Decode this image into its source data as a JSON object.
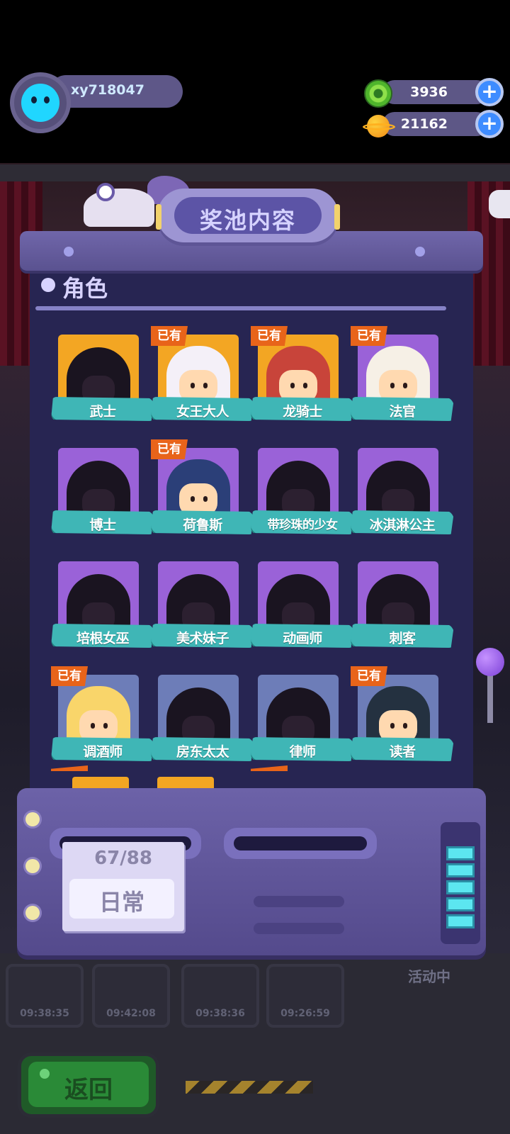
{
  "header": {
    "username": "xy718047",
    "currencies": [
      {
        "name": "green-donut-coin",
        "value": "3936"
      },
      {
        "name": "planet-coin",
        "value": "21162"
      }
    ],
    "plus_label": "+"
  },
  "panel": {
    "title": "奖池内容",
    "section_label": "角色"
  },
  "characters": [
    {
      "name": "武士",
      "owned": false,
      "card": "gold"
    },
    {
      "name": "女王大人",
      "owned": true,
      "card": "gold"
    },
    {
      "name": "龙骑士",
      "owned": true,
      "card": "gold"
    },
    {
      "name": "法官",
      "owned": true,
      "card": "purple"
    },
    {
      "name": "博士",
      "owned": false,
      "card": "purple"
    },
    {
      "name": "荷鲁斯",
      "owned": true,
      "card": "purple"
    },
    {
      "name": "带珍珠的少女",
      "owned": false,
      "card": "purple"
    },
    {
      "name": "冰淇淋公主",
      "owned": false,
      "card": "purple"
    },
    {
      "name": "培根女巫",
      "owned": false,
      "card": "purple"
    },
    {
      "name": "美术妹子",
      "owned": false,
      "card": "purple"
    },
    {
      "name": "动画师",
      "owned": false,
      "card": "purple"
    },
    {
      "name": "刺客",
      "owned": false,
      "card": "purple"
    },
    {
      "name": "调酒师",
      "owned": true,
      "card": "blue"
    },
    {
      "name": "房东太太",
      "owned": false,
      "card": "blue"
    },
    {
      "name": "律师",
      "owned": false,
      "card": "blue"
    },
    {
      "name": "读者",
      "owned": true,
      "card": "blue"
    }
  ],
  "owned_tag": "已有",
  "collection": {
    "count": "67/88",
    "pool_type": "日常"
  },
  "background": {
    "timers": [
      "09:38:35",
      "09:42:08",
      "09:38:36",
      "09:26:59"
    ],
    "event_label": "活动中"
  },
  "back_button": "返回",
  "colors": {
    "ribbon": "#3fb6b6",
    "owned_tag": "#e8641a",
    "card_gold": "#f3a623",
    "card_purple": "#9a62d8",
    "card_blue": "#6d7db8",
    "panel": "#272552"
  }
}
